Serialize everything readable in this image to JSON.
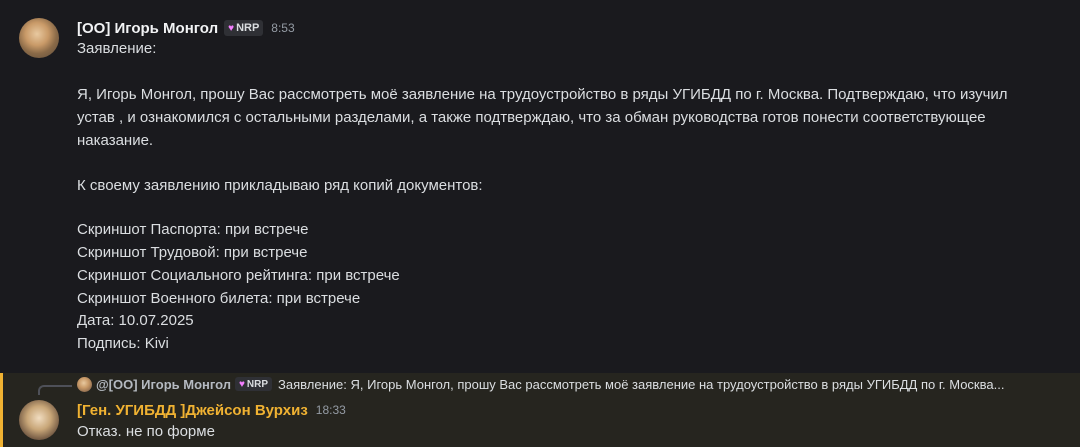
{
  "message1": {
    "username": "[OO] Игорь Монгол",
    "tag": {
      "icon": "heart",
      "label": "NRP"
    },
    "time": "8:53",
    "lines": [
      "Заявление:",
      "",
      "Я, Игорь Монгол, прошу Вас рассмотреть моё заявление на трудоустройство в ряды УГИБДД по г. Москва. Подтверждаю, что изучил",
      "устав , и ознакомился с остальными разделами, а также     подтверждаю, что за обман руководства готов понести соответствующее",
      "наказание.",
      "",
      "К своему заявлению прикладываю ряд копий документов:",
      "",
      "Скриншот Паспорта: при встрече",
      "Скриншот Трудовой: при встрече",
      "Скриншот Социального рейтинга: при встрече",
      "Скриншот Военного билета:  при встрече",
      "Дата: 10.07.2025",
      "Подпись: Kivi"
    ]
  },
  "message2": {
    "reply": {
      "username": "@[OO] Игорь Монгол",
      "tag_label": "NRP",
      "text": "Заявление:  Я, Игорь Монгол, прошу Вас рассмотреть моё заявление на трудоустройство в ряды УГИБДД по г. Москва..."
    },
    "username": "[Ген. УГИБДД ]Джейсон Вурхиз",
    "time": "18:33",
    "text": "Отказ. не по форме",
    "highlight_color": "#f0b232"
  }
}
